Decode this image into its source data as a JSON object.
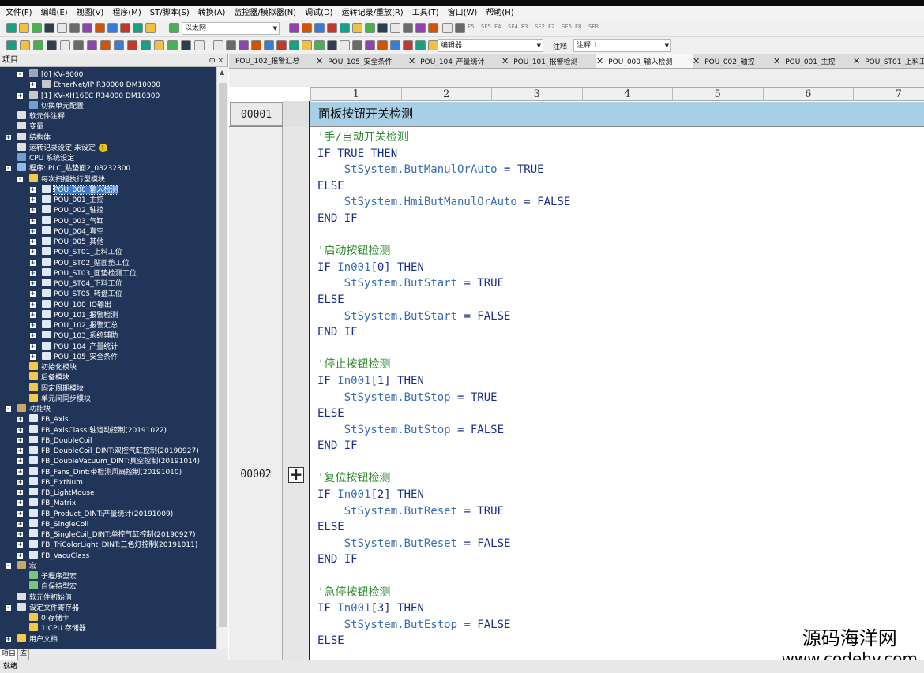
{
  "menu": [
    "文件(F)",
    "编辑(E)",
    "视图(V)",
    "程序(M)",
    "ST/脚本(S)",
    "转换(A)",
    "监控器/模拟器(N)",
    "调试(D)",
    "运转记录/重放(R)",
    "工具(T)",
    "窗口(W)",
    "帮助(H)"
  ],
  "toolbar": {
    "network_combo": "以太网",
    "editor_combo": "编辑器",
    "comment_label": "注释",
    "comment_combo": "注释 1",
    "fkeys": [
      "F5",
      "SF5",
      "F4",
      "SF4",
      "F3",
      "SF2",
      "F2",
      "SF6",
      "F8",
      "SF8"
    ]
  },
  "project_panel": {
    "title": "项目",
    "pin": "ф ×",
    "items": [
      {
        "label": "[0]  KV-8000",
        "lvl": 1,
        "exp": "-",
        "icon": "plc"
      },
      {
        "label": "EtherNet/IP   R30000  DM10000",
        "lvl": 2,
        "exp": "+",
        "icon": "unit"
      },
      {
        "label": "[1]  KV-XH16EC   R34000  DM10300",
        "lvl": 1,
        "exp": "+",
        "icon": "unit"
      },
      {
        "label": "切换单元配置",
        "lvl": 1,
        "exp": "",
        "icon": "cfg"
      },
      {
        "label": "软元件注释",
        "lvl": 0,
        "exp": "",
        "icon": "doc"
      },
      {
        "label": "变量",
        "lvl": 0,
        "exp": "",
        "icon": "doc"
      },
      {
        "label": "结构体",
        "lvl": 0,
        "exp": "+",
        "icon": "doc"
      },
      {
        "label": "运转记录设定 未设定",
        "lvl": 0,
        "exp": "",
        "icon": "doc",
        "warn": "!"
      },
      {
        "label": "CPU 系统设定",
        "lvl": 0,
        "exp": "",
        "icon": "cfg"
      },
      {
        "label": "程序: PLC_贴垫面2_08232300",
        "lvl": 0,
        "exp": "-",
        "icon": "prog"
      },
      {
        "label": "每次扫描执行型模块",
        "lvl": 1,
        "exp": "-",
        "icon": "folder"
      },
      {
        "label": "POU_000_输入检测",
        "lvl": 2,
        "exp": "+",
        "icon": "file",
        "sel": true
      },
      {
        "label": "POU_001_主控",
        "lvl": 2,
        "exp": "+",
        "icon": "file"
      },
      {
        "label": "POU_002_轴控",
        "lvl": 2,
        "exp": "+",
        "icon": "file"
      },
      {
        "label": "POU_003_气缸",
        "lvl": 2,
        "exp": "+",
        "icon": "file"
      },
      {
        "label": "POU_004_真空",
        "lvl": 2,
        "exp": "+",
        "icon": "file"
      },
      {
        "label": "POU_005_其他",
        "lvl": 2,
        "exp": "+",
        "icon": "file"
      },
      {
        "label": "POU_ST01_上料工位",
        "lvl": 2,
        "exp": "+",
        "icon": "file"
      },
      {
        "label": "POU_ST02_贴面垫工位",
        "lvl": 2,
        "exp": "+",
        "icon": "file"
      },
      {
        "label": "POU_ST03_面垫检测工位",
        "lvl": 2,
        "exp": "+",
        "icon": "file"
      },
      {
        "label": "POU_ST04_下料工位",
        "lvl": 2,
        "exp": "+",
        "icon": "file"
      },
      {
        "label": "POU_ST05_转盘工位",
        "lvl": 2,
        "exp": "+",
        "icon": "file"
      },
      {
        "label": "POU_100_IO输出",
        "lvl": 2,
        "exp": "+",
        "icon": "file"
      },
      {
        "label": "POU_101_报警检测",
        "lvl": 2,
        "exp": "+",
        "icon": "file"
      },
      {
        "label": "POU_102_报警汇总",
        "lvl": 2,
        "exp": "+",
        "icon": "file"
      },
      {
        "label": "POU_103_系统辅助",
        "lvl": 2,
        "exp": "+",
        "icon": "file"
      },
      {
        "label": "POU_104_产量统计",
        "lvl": 2,
        "exp": "+",
        "icon": "file"
      },
      {
        "label": "POU_105_安全条件",
        "lvl": 2,
        "exp": "+",
        "icon": "file"
      },
      {
        "label": "初始化模块",
        "lvl": 1,
        "exp": "",
        "icon": "folder"
      },
      {
        "label": "后备模块",
        "lvl": 1,
        "exp": "",
        "icon": "folder"
      },
      {
        "label": "固定周期模块",
        "lvl": 1,
        "exp": "",
        "icon": "folder"
      },
      {
        "label": "单元间同步模块",
        "lvl": 1,
        "exp": "",
        "icon": "folder"
      },
      {
        "label": "功能块",
        "lvl": 0,
        "exp": "-",
        "icon": "fb"
      },
      {
        "label": "FB_Axis",
        "lvl": 1,
        "exp": "+",
        "icon": "file"
      },
      {
        "label": "FB_AxisClass:轴运动控制(20191022)",
        "lvl": 1,
        "exp": "+",
        "icon": "file"
      },
      {
        "label": "FB_DoubleCoil",
        "lvl": 1,
        "exp": "+",
        "icon": "file"
      },
      {
        "label": "FB_DoubleCoil_DINT:双控气缸控制(20190927)",
        "lvl": 1,
        "exp": "+",
        "icon": "file"
      },
      {
        "label": "FB_DoubleVacuum_DINT:真空控制(20191014)",
        "lvl": 1,
        "exp": "+",
        "icon": "file"
      },
      {
        "label": "FB_Fans_Dint:带检测风扇控制(20191010)",
        "lvl": 1,
        "exp": "+",
        "icon": "file"
      },
      {
        "label": "FB_FixtNum",
        "lvl": 1,
        "exp": "+",
        "icon": "file"
      },
      {
        "label": "FB_LightMouse",
        "lvl": 1,
        "exp": "+",
        "icon": "file"
      },
      {
        "label": "FB_Matrix",
        "lvl": 1,
        "exp": "+",
        "icon": "file"
      },
      {
        "label": "FB_Product_DINT:产量统计(20191009)",
        "lvl": 1,
        "exp": "+",
        "icon": "file"
      },
      {
        "label": "FB_SingleCoil",
        "lvl": 1,
        "exp": "+",
        "icon": "file"
      },
      {
        "label": "FB_SingleCoil_DINT:单控气缸控制(20190927)",
        "lvl": 1,
        "exp": "+",
        "icon": "file"
      },
      {
        "label": "FB_TriColorLight_DINT:三色灯控制(20191011)",
        "lvl": 1,
        "exp": "+",
        "icon": "file"
      },
      {
        "label": "FB_VacuClass",
        "lvl": 1,
        "exp": "+",
        "icon": "file"
      },
      {
        "label": "宏",
        "lvl": 0,
        "exp": "-",
        "icon": "fb"
      },
      {
        "label": "子程序型宏",
        "lvl": 1,
        "exp": "",
        "icon": "macro"
      },
      {
        "label": "自保持型宏",
        "lvl": 1,
        "exp": "",
        "icon": "macro"
      },
      {
        "label": "软元件初始值",
        "lvl": 0,
        "exp": "",
        "icon": "doc"
      },
      {
        "label": "设定文件寄存器",
        "lvl": 0,
        "exp": "-",
        "icon": "doc"
      },
      {
        "label": "0:存储卡",
        "lvl": 1,
        "exp": "",
        "icon": "folder"
      },
      {
        "label": "1:CPU 存储器",
        "lvl": 1,
        "exp": "",
        "icon": "folder"
      },
      {
        "label": "用户文档",
        "lvl": 0,
        "exp": "+",
        "icon": "folder"
      }
    ],
    "bottom_tabs": [
      "项目",
      "库"
    ]
  },
  "tabs": [
    "POU_102_报警汇总",
    "POU_105_安全条件",
    "POU_104_产量统计",
    "POU_101_报警检测",
    "POU_000_输入检测",
    "POU_002_轴控",
    "POU_001_主控",
    "POU_ST01_上料工"
  ],
  "active_tab": 4,
  "columns": [
    "1",
    "2",
    "3",
    "4",
    "5",
    "6",
    "7"
  ],
  "row1": {
    "num": "00001",
    "title": "面板按钮开关检测"
  },
  "row2": {
    "num": "00002",
    "plus": "+"
  },
  "code": [
    [
      {
        "t": "'手/自动开关检测",
        "c": "cm"
      }
    ],
    [
      {
        "t": "IF TRUE THEN",
        "c": "kw"
      }
    ],
    [
      {
        "t": "    "
      },
      {
        "t": "StSystem.ButManulOrAuto",
        "c": "id"
      },
      {
        "t": " = TRUE",
        "c": "tx"
      }
    ],
    [
      {
        "t": "ELSE",
        "c": "kw"
      }
    ],
    [
      {
        "t": "    "
      },
      {
        "t": "StSystem.HmiButManulOrAuto",
        "c": "id"
      },
      {
        "t": " = FALSE",
        "c": "tx"
      }
    ],
    [
      {
        "t": "END IF",
        "c": "kw"
      }
    ],
    [
      {
        "t": ""
      }
    ],
    [
      {
        "t": "'启动按钮检测",
        "c": "cm"
      }
    ],
    [
      {
        "t": "IF ",
        "c": "kw"
      },
      {
        "t": "In001",
        "c": "id"
      },
      {
        "t": "[0] THEN",
        "c": "kw"
      }
    ],
    [
      {
        "t": "    "
      },
      {
        "t": "StSystem.ButStart",
        "c": "id"
      },
      {
        "t": " = TRUE",
        "c": "tx"
      }
    ],
    [
      {
        "t": "ELSE",
        "c": "kw"
      }
    ],
    [
      {
        "t": "    "
      },
      {
        "t": "StSystem.ButStart",
        "c": "id"
      },
      {
        "t": " = FALSE",
        "c": "tx"
      }
    ],
    [
      {
        "t": "END IF",
        "c": "kw"
      }
    ],
    [
      {
        "t": ""
      }
    ],
    [
      {
        "t": "'停止按钮检测",
        "c": "cm"
      }
    ],
    [
      {
        "t": "IF ",
        "c": "kw"
      },
      {
        "t": "In001",
        "c": "id"
      },
      {
        "t": "[1] THEN",
        "c": "kw"
      }
    ],
    [
      {
        "t": "    "
      },
      {
        "t": "StSystem.ButStop",
        "c": "id"
      },
      {
        "t": " = TRUE",
        "c": "tx"
      }
    ],
    [
      {
        "t": "ELSE",
        "c": "kw"
      }
    ],
    [
      {
        "t": "    "
      },
      {
        "t": "StSystem.ButStop",
        "c": "id"
      },
      {
        "t": " = FALSE",
        "c": "tx"
      }
    ],
    [
      {
        "t": "END IF",
        "c": "kw"
      }
    ],
    [
      {
        "t": ""
      }
    ],
    [
      {
        "t": "'复位按钮检测",
        "c": "cm"
      }
    ],
    [
      {
        "t": "IF ",
        "c": "kw"
      },
      {
        "t": "In001",
        "c": "id"
      },
      {
        "t": "[2] THEN",
        "c": "kw"
      }
    ],
    [
      {
        "t": "    "
      },
      {
        "t": "StSystem.ButReset",
        "c": "id"
      },
      {
        "t": " = TRUE",
        "c": "tx"
      }
    ],
    [
      {
        "t": "ELSE",
        "c": "kw"
      }
    ],
    [
      {
        "t": "    "
      },
      {
        "t": "StSystem.ButReset",
        "c": "id"
      },
      {
        "t": " = FALSE",
        "c": "tx"
      }
    ],
    [
      {
        "t": "END IF",
        "c": "kw"
      }
    ],
    [
      {
        "t": ""
      }
    ],
    [
      {
        "t": "'急停按钮检测",
        "c": "cm"
      }
    ],
    [
      {
        "t": "IF ",
        "c": "kw"
      },
      {
        "t": "In001",
        "c": "id"
      },
      {
        "t": "[3] THEN",
        "c": "kw"
      }
    ],
    [
      {
        "t": "    "
      },
      {
        "t": "StSystem.ButEstop",
        "c": "id"
      },
      {
        "t": " = FALSE",
        "c": "tx"
      }
    ],
    [
      {
        "t": "ELSE",
        "c": "kw"
      }
    ]
  ],
  "status": "就绪",
  "watermark": {
    "line1": "源码海洋网",
    "line2": "www.codehy.com"
  },
  "colors": {
    "tree_bg": "#203558",
    "title_bar": "#a8cfe6",
    "comment": "#2e8b2e",
    "keyword": "#1a2f86",
    "identifier": "#3a6fb0"
  }
}
